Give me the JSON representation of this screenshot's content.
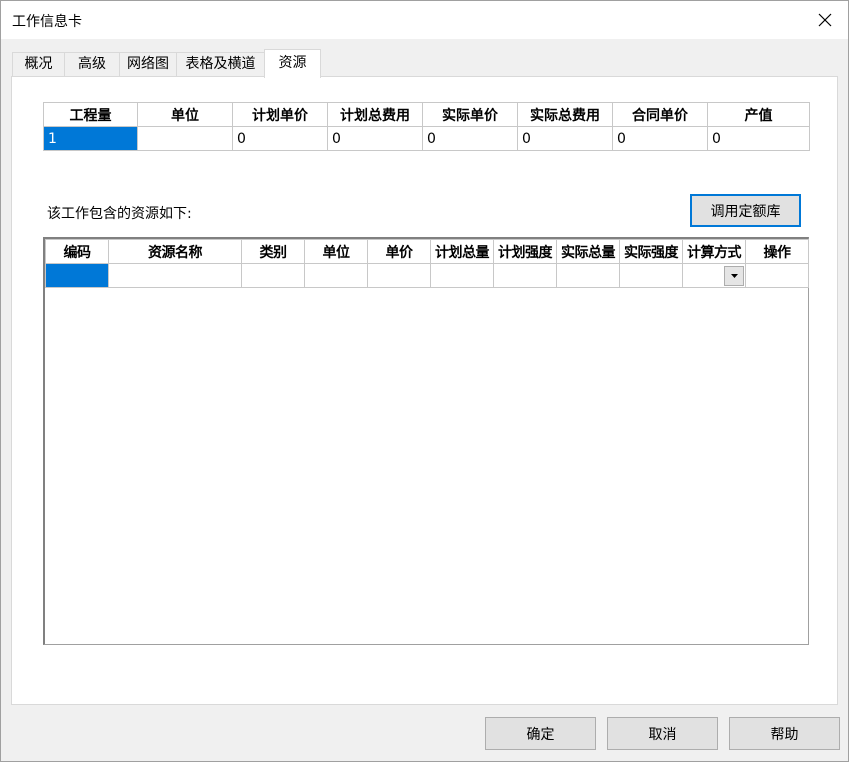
{
  "window": {
    "title": "工作信息卡"
  },
  "tabs": [
    {
      "label": "概况"
    },
    {
      "label": "高级"
    },
    {
      "label": "网络图"
    },
    {
      "label": "表格及横道"
    },
    {
      "label": "资源"
    }
  ],
  "summary_table": {
    "headers": [
      "工程量",
      "单位",
      "计划单价",
      "计划总费用",
      "实际单价",
      "实际总费用",
      "合同单价",
      "产值"
    ],
    "row": [
      "1",
      "",
      "0",
      "0",
      "0",
      "0",
      "0",
      "0"
    ]
  },
  "resources": {
    "label": "该工作包含的资源如下:",
    "quota_button": "调用定额库",
    "headers": [
      "编码",
      "资源名称",
      "类别",
      "单位",
      "单价",
      "计划总量",
      "计划强度",
      "实际总量",
      "实际强度",
      "计算方式",
      "操作"
    ],
    "row": [
      "",
      "",
      "",
      "",
      "",
      "",
      "",
      "",
      "",
      "",
      ""
    ]
  },
  "buttons": {
    "ok": "确定",
    "cancel": "取消",
    "help": "帮助"
  },
  "colors": {
    "selection": "#0078d7",
    "focus_border": "#0078d7"
  }
}
